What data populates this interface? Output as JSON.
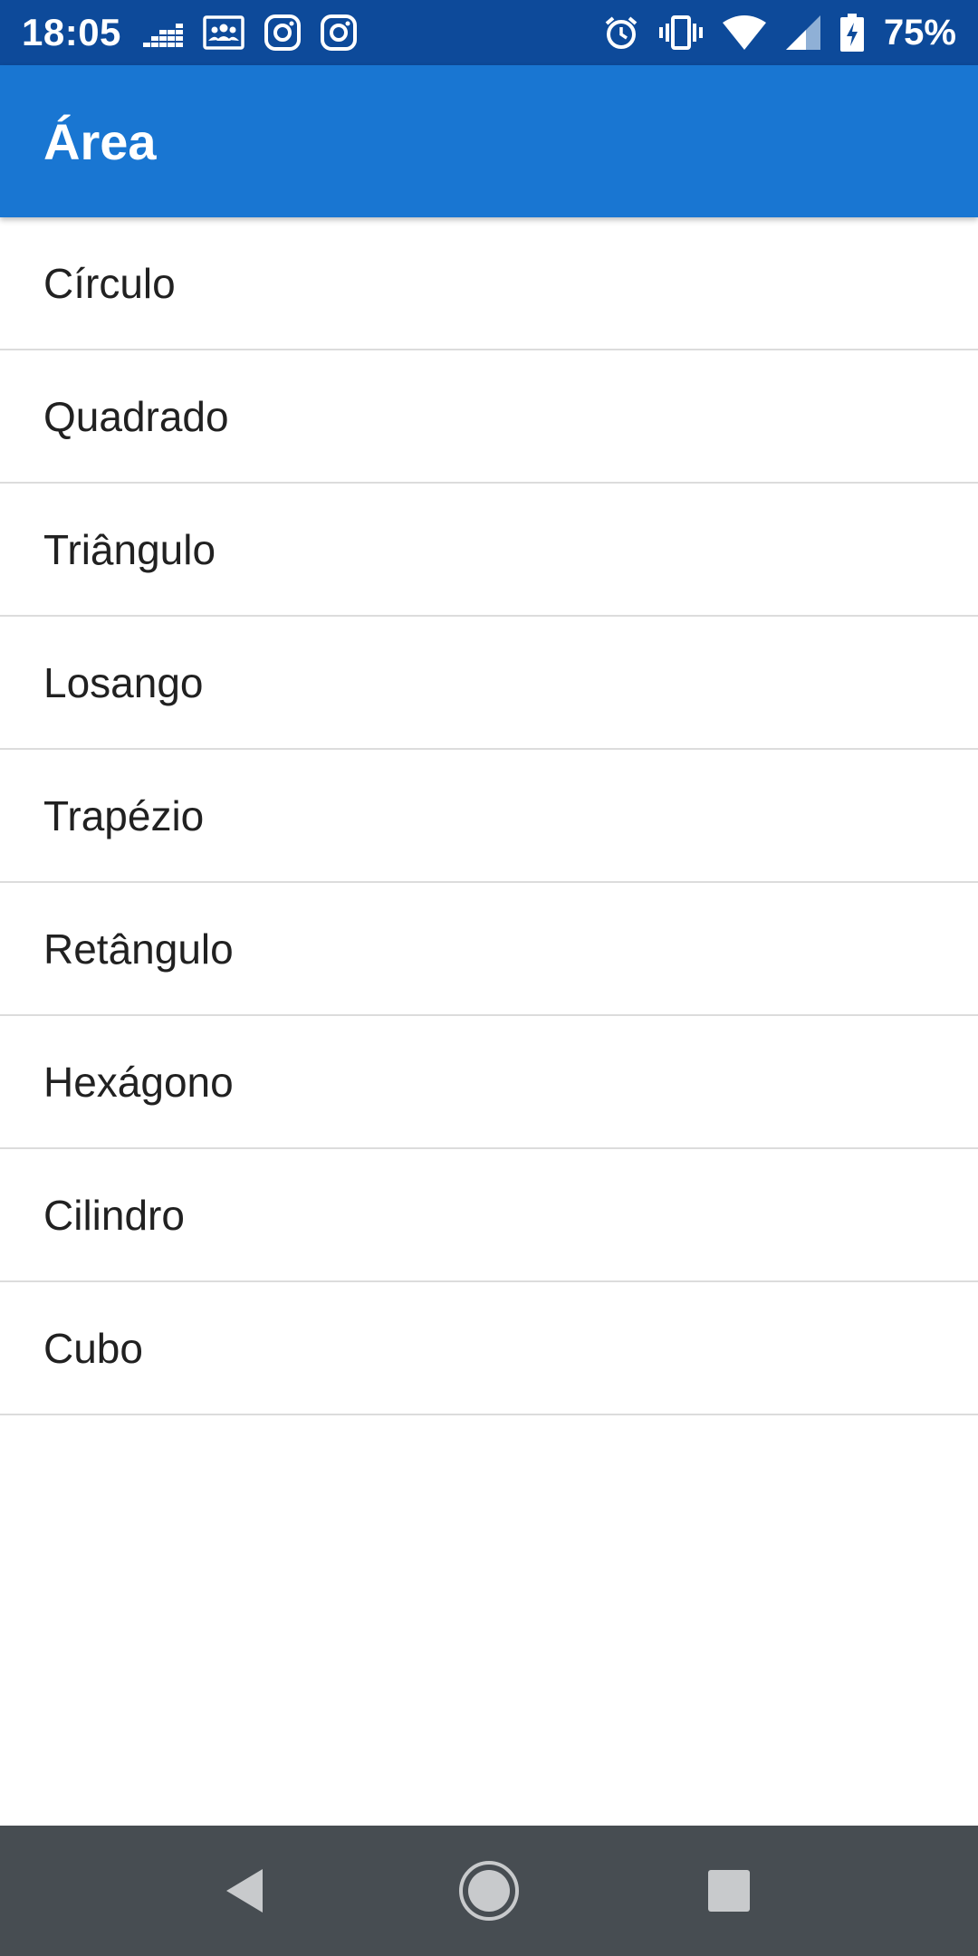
{
  "status_bar": {
    "time": "18:05",
    "battery_percent": "75%",
    "background_color": "#0d4a9a",
    "left_icons": [
      "deezer-icon",
      "contacts-card-icon",
      "instagram-icon",
      "instagram-icon"
    ],
    "right_icons": [
      "alarm-icon",
      "vibrate-icon",
      "wifi-icon",
      "cell-signal-icon",
      "battery-charging-icon"
    ]
  },
  "app_bar": {
    "title": "Área",
    "background_color": "#1976d2"
  },
  "list": {
    "items": [
      {
        "label": "Círculo"
      },
      {
        "label": "Quadrado"
      },
      {
        "label": "Triângulo"
      },
      {
        "label": "Losango"
      },
      {
        "label": "Trapézio"
      },
      {
        "label": "Retângulo"
      },
      {
        "label": "Hexágono"
      },
      {
        "label": "Cilindro"
      },
      {
        "label": "Cubo"
      }
    ]
  },
  "nav_bar": {
    "background_color": "#474d52",
    "buttons": [
      "back-icon",
      "home-icon",
      "recents-icon"
    ]
  }
}
